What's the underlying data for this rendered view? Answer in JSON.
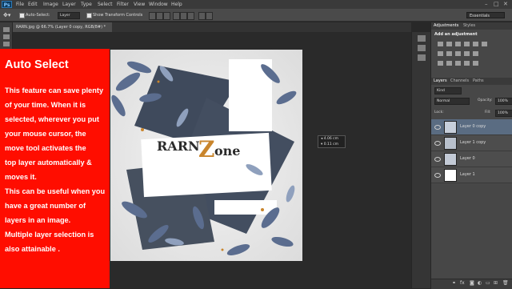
{
  "app": {
    "logo": "Ps",
    "menus": [
      "File",
      "Edit",
      "Image",
      "Layer",
      "Type",
      "Select",
      "Filter",
      "View",
      "Window",
      "Help"
    ],
    "window_controls": [
      "–",
      "□",
      "✕"
    ]
  },
  "options_bar": {
    "auto_select_label": "Auto-Select:",
    "auto_select_target": "Layer",
    "show_transform_label": "Show Transform Controls",
    "workspace": "Essentials"
  },
  "document": {
    "tab_title": "RARN.jpg @ 66.7% (Layer 0 copy, RGB/8#) *",
    "logo_text_1": "RARN",
    "logo_text_2": "Z",
    "logo_text_3": "one"
  },
  "measure": {
    "dx": "4.06 cm",
    "dy": "0.11 cm"
  },
  "red_panel": {
    "title": "Auto Select",
    "lines": [
      "This feature can save plenty",
      "of your time. When it is",
      "selected, wherever you put",
      "your mouse cursor, the",
      "move tool activates  the",
      "top layer automatically &",
      "moves it.",
      "This can be useful when you",
      "have a great number of",
      "layers in an image.",
      "Multiple layer selection is",
      "also attainable ."
    ]
  },
  "panels": {
    "adj_tabs": [
      "Adjustments",
      "Styles"
    ],
    "add_adjustment": "Add an adjustment",
    "layer_tabs": [
      "Layers",
      "Channels",
      "Paths"
    ],
    "kind": "Kind",
    "blend_mode": "Normal",
    "opacity_label": "Opacity:",
    "opacity_value": "100%",
    "lock_label": "Lock:",
    "fill_label": "Fill:",
    "fill_value": "100%",
    "layers": [
      {
        "name": "Layer 0 copy"
      },
      {
        "name": "Layer 1 copy"
      },
      {
        "name": "Layer 0"
      },
      {
        "name": "Layer 1"
      }
    ],
    "footer_icons": [
      "link-icon",
      "fx-icon",
      "mask-icon",
      "adjustment-icon",
      "folder-icon",
      "new-layer-icon",
      "trash-icon"
    ]
  }
}
